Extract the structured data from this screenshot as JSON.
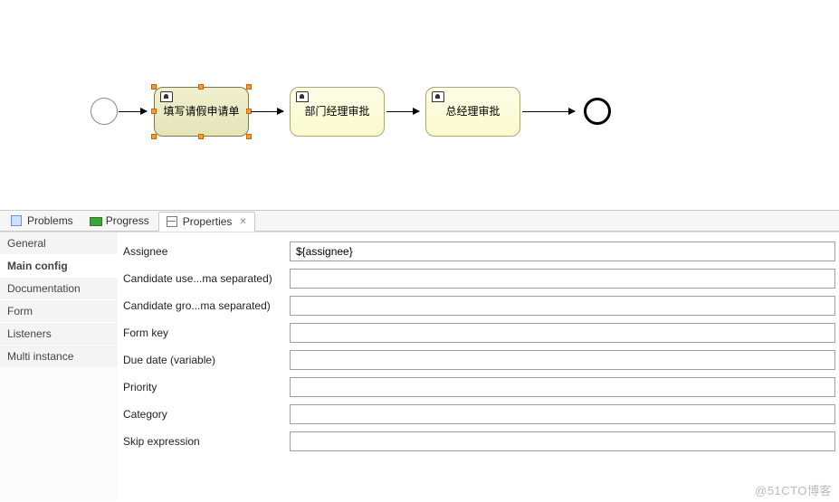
{
  "diagram": {
    "start": "start-event",
    "end": "end-event",
    "tasks": [
      {
        "id": "task1",
        "label": "填写请假申请单",
        "selected": true
      },
      {
        "id": "task2",
        "label": "部门经理审批",
        "selected": false
      },
      {
        "id": "task3",
        "label": "总经理审批",
        "selected": false
      }
    ]
  },
  "tabs": {
    "problems": "Problems",
    "progress": "Progress",
    "properties": "Properties"
  },
  "sideTabs": {
    "general": "General",
    "mainConfig": "Main config",
    "documentation": "Documentation",
    "form": "Form",
    "listeners": "Listeners",
    "multiInstance": "Multi instance"
  },
  "props": {
    "assignee": {
      "label": "Assignee",
      "value": "${assignee}"
    },
    "candidateUsers": {
      "label": "Candidate use...ma separated)",
      "value": ""
    },
    "candidateGroups": {
      "label": "Candidate gro...ma separated)",
      "value": ""
    },
    "formKey": {
      "label": "Form key",
      "value": ""
    },
    "dueDate": {
      "label": "Due date (variable)",
      "value": ""
    },
    "priority": {
      "label": "Priority",
      "value": ""
    },
    "category": {
      "label": "Category",
      "value": ""
    },
    "skipExpression": {
      "label": "Skip expression",
      "value": ""
    }
  },
  "watermark": "@51CTO博客"
}
